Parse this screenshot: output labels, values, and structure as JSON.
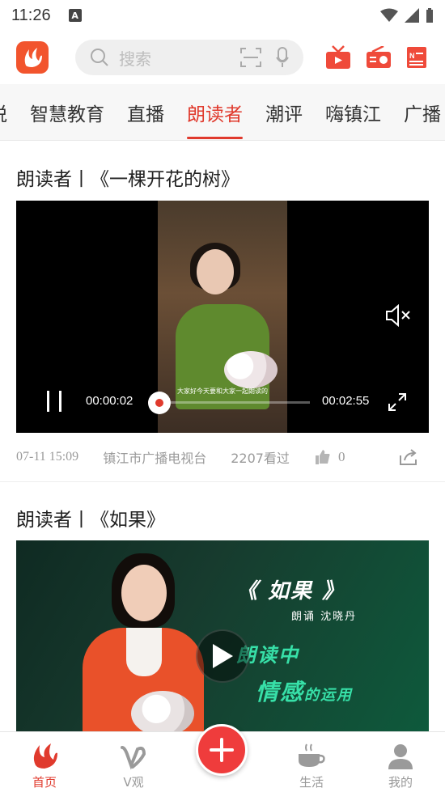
{
  "status_bar": {
    "time": "11:26",
    "notif": "A"
  },
  "header": {
    "search_placeholder": "搜索",
    "icons": [
      "app-logo",
      "search-icon",
      "scan-icon",
      "mic-icon",
      "tv-icon",
      "radio-icon",
      "news-icon"
    ]
  },
  "tabs": [
    {
      "label": "悦",
      "active": false
    },
    {
      "label": "智慧教育",
      "active": false
    },
    {
      "label": "直播",
      "active": false
    },
    {
      "label": "朗读者",
      "active": true
    },
    {
      "label": "潮评",
      "active": false
    },
    {
      "label": "嗨镇江",
      "active": false
    },
    {
      "label": "广播",
      "active": false
    }
  ],
  "articles": [
    {
      "title": "朗读者丨《一棵开花的树》",
      "video": {
        "subtitle": "大家好今天要和大家一起朗读的",
        "current_time": "00:00:02",
        "total_time": "00:02:55",
        "progress": 0.07
      },
      "meta": {
        "date": "07-11 15:09",
        "source": "镇江市广播电视台",
        "views": "2207看过",
        "likes": "0"
      }
    },
    {
      "title": "朗读者丨《如果》",
      "cover": {
        "title": "《 如果 》",
        "reader": "朗诵 沈晓丹",
        "headline1": "朗读中",
        "headline2": "情感",
        "headline2_small": "的运用"
      }
    }
  ],
  "bottom_nav": {
    "items": [
      {
        "label": "首页",
        "active": true
      },
      {
        "label": "V观",
        "active": false
      },
      {
        "label": "生活",
        "active": false
      },
      {
        "label": "我的",
        "active": false
      }
    ]
  },
  "colors": {
    "accent": "#e03a2d",
    "brand": "#f2542d"
  }
}
